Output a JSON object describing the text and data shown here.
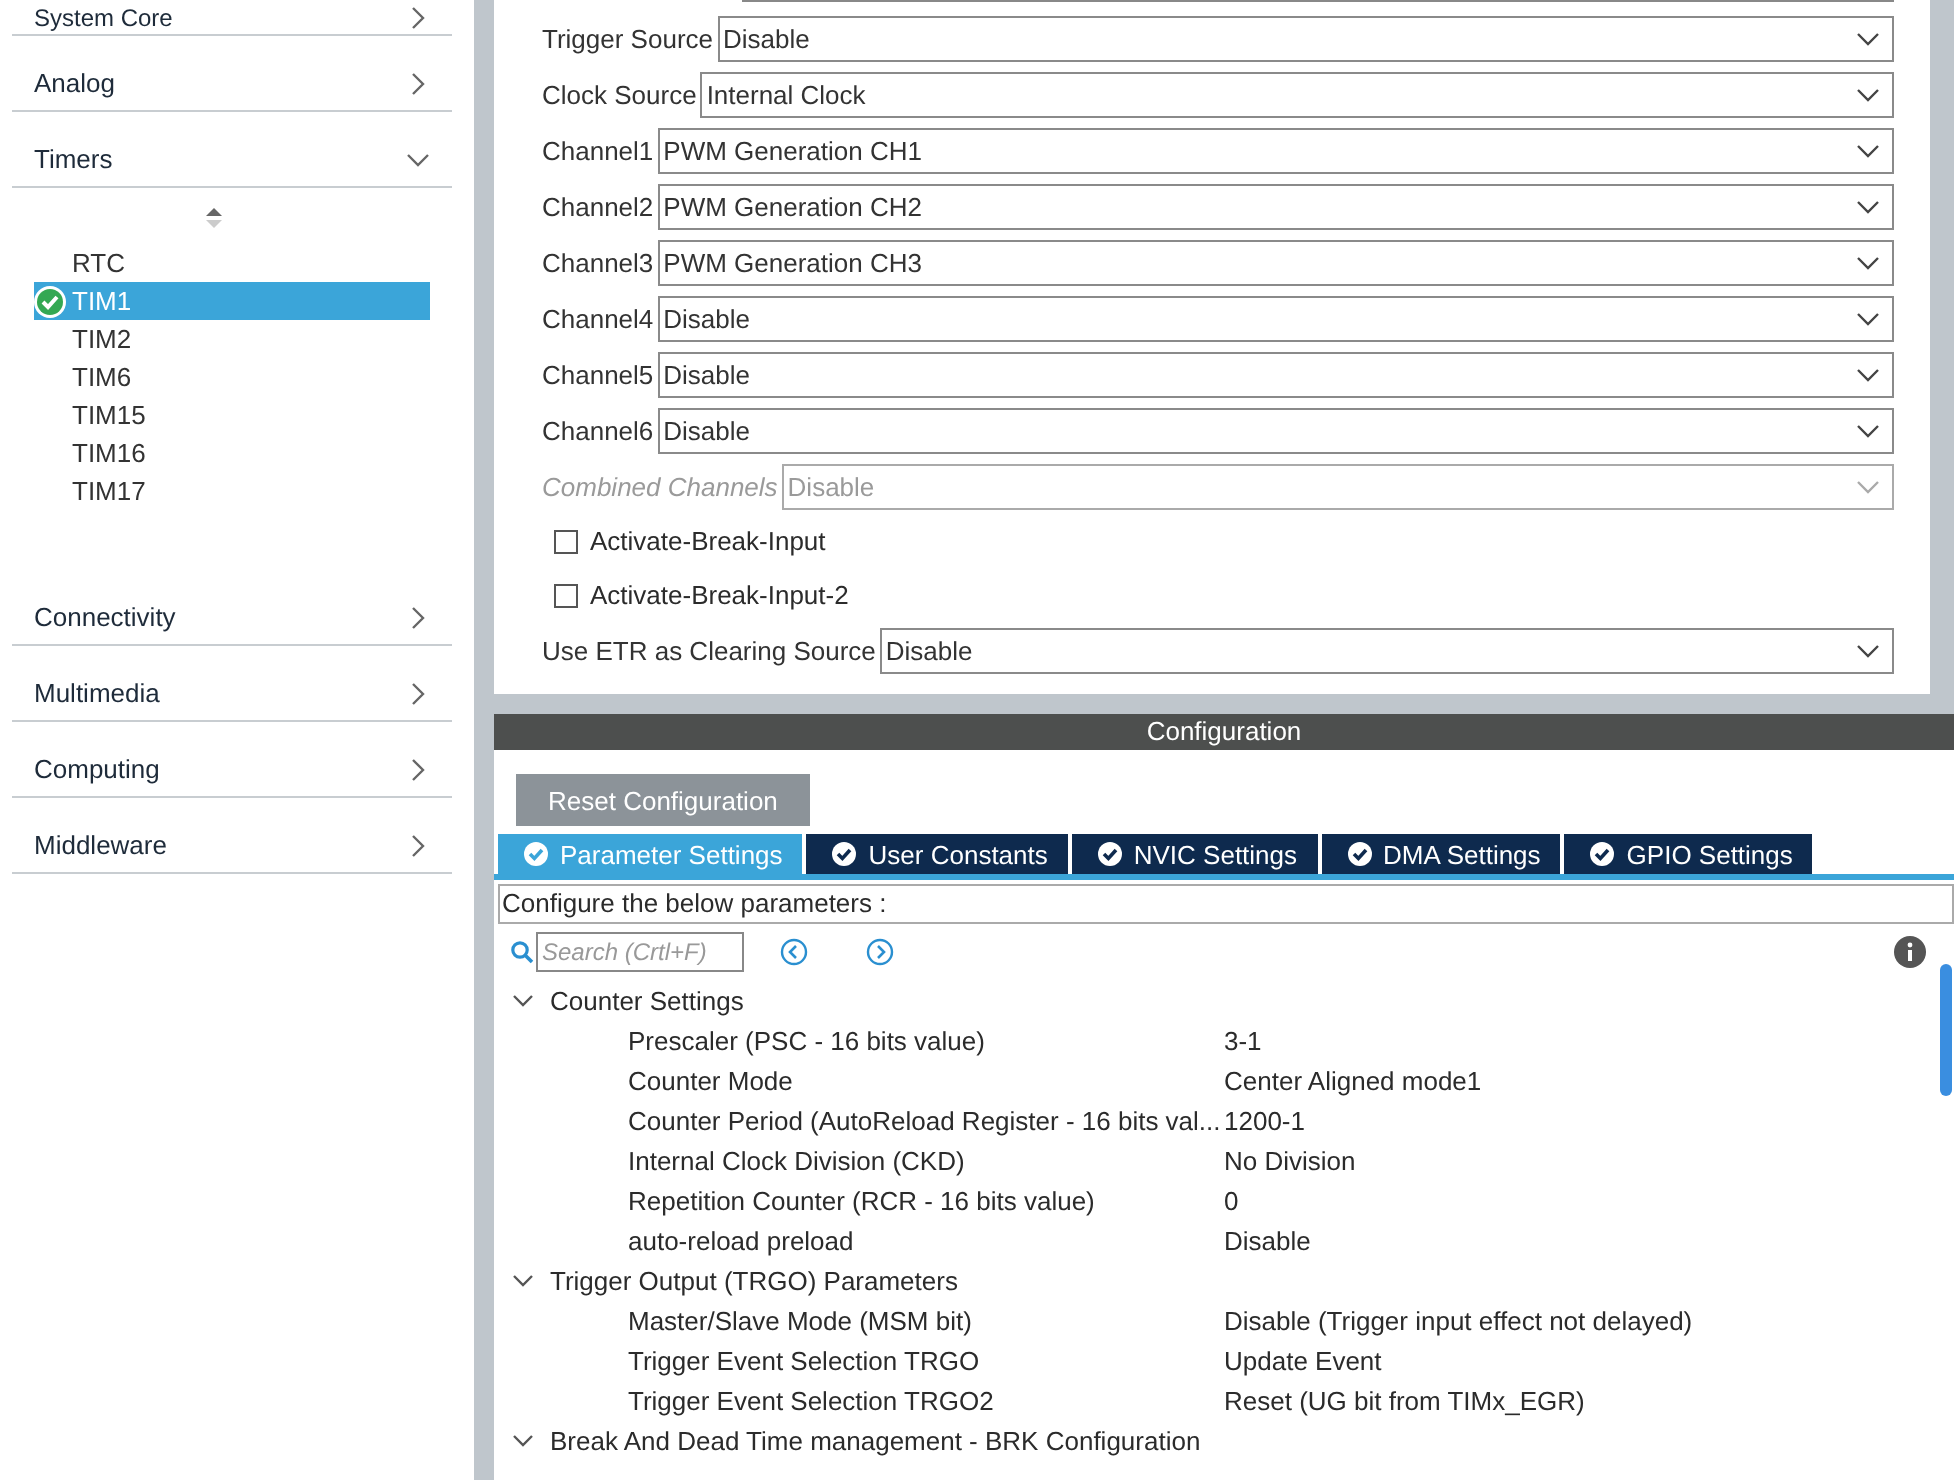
{
  "sidebar": {
    "categories": [
      {
        "label": "System Core",
        "expanded": false
      },
      {
        "label": "Analog",
        "expanded": false
      },
      {
        "label": "Timers",
        "expanded": true,
        "children": [
          {
            "label": "RTC",
            "selected": false,
            "configured": false
          },
          {
            "label": "TIM1",
            "selected": true,
            "configured": true
          },
          {
            "label": "TIM2",
            "selected": false,
            "configured": false
          },
          {
            "label": "TIM6",
            "selected": false,
            "configured": false
          },
          {
            "label": "TIM15",
            "selected": false,
            "configured": false
          },
          {
            "label": "TIM16",
            "selected": false,
            "configured": false
          },
          {
            "label": "TIM17",
            "selected": false,
            "configured": false
          }
        ]
      },
      {
        "label": "Connectivity",
        "expanded": false
      },
      {
        "label": "Multimedia",
        "expanded": false
      },
      {
        "label": "Computing",
        "expanded": false
      },
      {
        "label": "Middleware",
        "expanded": false
      }
    ]
  },
  "mode": {
    "rows": [
      {
        "kind": "select",
        "label": "Trigger Source",
        "value": "Disable",
        "disabled": false
      },
      {
        "kind": "select",
        "label": "Clock Source",
        "value": "Internal Clock",
        "disabled": false
      },
      {
        "kind": "select",
        "label": "Channel1",
        "value": "PWM Generation CH1",
        "disabled": false
      },
      {
        "kind": "select",
        "label": "Channel2",
        "value": "PWM Generation CH2",
        "disabled": false
      },
      {
        "kind": "select",
        "label": "Channel3",
        "value": "PWM Generation CH3",
        "disabled": false
      },
      {
        "kind": "select",
        "label": "Channel4",
        "value": "Disable",
        "disabled": false
      },
      {
        "kind": "select",
        "label": "Channel5",
        "value": "Disable",
        "disabled": false
      },
      {
        "kind": "select",
        "label": "Channel6",
        "value": "Disable",
        "disabled": false
      },
      {
        "kind": "select",
        "label": "Combined Channels",
        "value": "Disable",
        "disabled": true
      },
      {
        "kind": "checkbox",
        "label": "Activate-Break-Input",
        "checked": false
      },
      {
        "kind": "checkbox",
        "label": "Activate-Break-Input-2",
        "checked": false
      },
      {
        "kind": "select",
        "label": "Use ETR as Clearing Source",
        "value": "Disable",
        "disabled": false
      }
    ]
  },
  "configuration": {
    "title": "Configuration",
    "reset_button": "Reset Configuration",
    "tabs": [
      {
        "label": "Parameter Settings",
        "selected": true
      },
      {
        "label": "User Constants",
        "selected": false
      },
      {
        "label": "NVIC Settings",
        "selected": false
      },
      {
        "label": "DMA Settings",
        "selected": false
      },
      {
        "label": "GPIO Settings",
        "selected": false
      }
    ],
    "hint": "Configure the below parameters :",
    "search": {
      "placeholder": "Search (Crtl+F)"
    },
    "groups": [
      {
        "label": "Counter Settings",
        "expanded": true,
        "params": [
          {
            "name": "Prescaler (PSC - 16 bits value)",
            "value": "3-1"
          },
          {
            "name": "Counter Mode",
            "value": "Center Aligned mode1"
          },
          {
            "name": "Counter Period (AutoReload Register - 16 bits val...",
            "value": "1200-1"
          },
          {
            "name": "Internal Clock Division (CKD)",
            "value": "No Division"
          },
          {
            "name": "Repetition Counter (RCR - 16 bits value)",
            "value": "0"
          },
          {
            "name": "auto-reload preload",
            "value": "Disable"
          }
        ]
      },
      {
        "label": "Trigger Output (TRGO) Parameters",
        "expanded": true,
        "params": [
          {
            "name": "Master/Slave Mode (MSM bit)",
            "value": "Disable (Trigger input effect not delayed)"
          },
          {
            "name": "Trigger Event Selection TRGO",
            "value": "Update Event"
          },
          {
            "name": "Trigger Event Selection TRGO2",
            "value": "Reset (UG bit from TIMx_EGR)"
          }
        ]
      },
      {
        "label": "Break And Dead Time management - BRK Configuration",
        "expanded": true
      }
    ]
  }
}
